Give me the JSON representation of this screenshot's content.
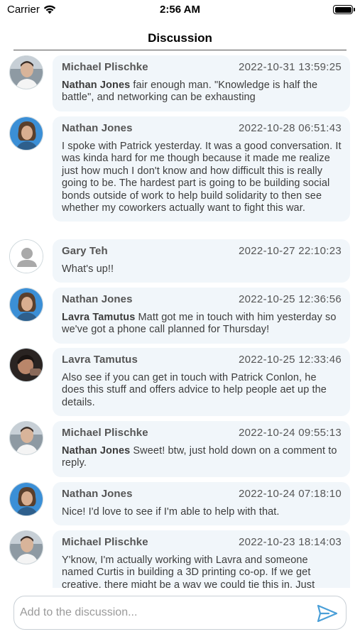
{
  "status_bar": {
    "carrier": "Carrier",
    "time": "2:56 AM"
  },
  "nav": {
    "title": "Discussion"
  },
  "comments": [
    {
      "author": "Michael Plischke",
      "timestamp": "2022-10-31 13:59:25",
      "mention": "Nathan Jones",
      "text": " fair enough man. \"Knowledge is half the battle\", and networking can be exhausting",
      "avatar": "person-photo-icon"
    },
    {
      "author": "Nathan Jones",
      "timestamp": "2022-10-28 06:51:43",
      "mention": "",
      "text": "I spoke with Patrick yesterday. It was a good conversation. It was kinda hard for me though because it made me realize just how much I don't know and how difficult this is really going to be. The hardest part is going to be building social bonds outside of work to help build solidarity to then see whether my coworkers actually want to fight this war.",
      "avatar": "person-photo-icon"
    },
    {
      "author": "Gary Teh",
      "timestamp": "2022-10-27 22:10:23",
      "mention": "",
      "text": "What's up!!",
      "avatar": "default-user-icon"
    },
    {
      "author": "Nathan Jones",
      "timestamp": "2022-10-25 12:36:56",
      "mention": "Lavra Tamutus",
      "text": " Matt got me in touch with him yesterday so we've got a phone call planned for Thursday!",
      "avatar": "person-photo-icon"
    },
    {
      "author": "Lavra Tamutus",
      "timestamp": "2022-10-25 12:33:46",
      "mention": "",
      "text": "Also see if you can get in touch with Patrick Conlon, he does this stuff and offers advice to help people aet up the details.",
      "avatar": "person-photo-icon"
    },
    {
      "author": "Michael Plischke",
      "timestamp": "2022-10-24 09:55:13",
      "mention": "Nathan Jones",
      "text": " Sweet! btw, just hold down on a comment to reply.",
      "avatar": "person-photo-icon"
    },
    {
      "author": "Nathan Jones",
      "timestamp": "2022-10-24 07:18:10",
      "mention": "",
      "text": "Nice! I'd love to see if I'm able to help with that.",
      "avatar": "person-photo-icon"
    },
    {
      "author": "Michael Plischke",
      "timestamp": "2022-10-23 18:14:03",
      "mention": "",
      "text": "Y'know, I'm actually working with Lavra and someone named Curtis in building a 3D printing co-op. If we get creative, there might be a way we could tie this in. Just",
      "avatar": "person-photo-icon"
    }
  ],
  "composer": {
    "placeholder": "Add to the discussion...",
    "send_icon": "send-icon"
  },
  "colors": {
    "bubble": "#f1f6fa",
    "accent": "#4a9fd8",
    "text": "#3c3c3c"
  }
}
